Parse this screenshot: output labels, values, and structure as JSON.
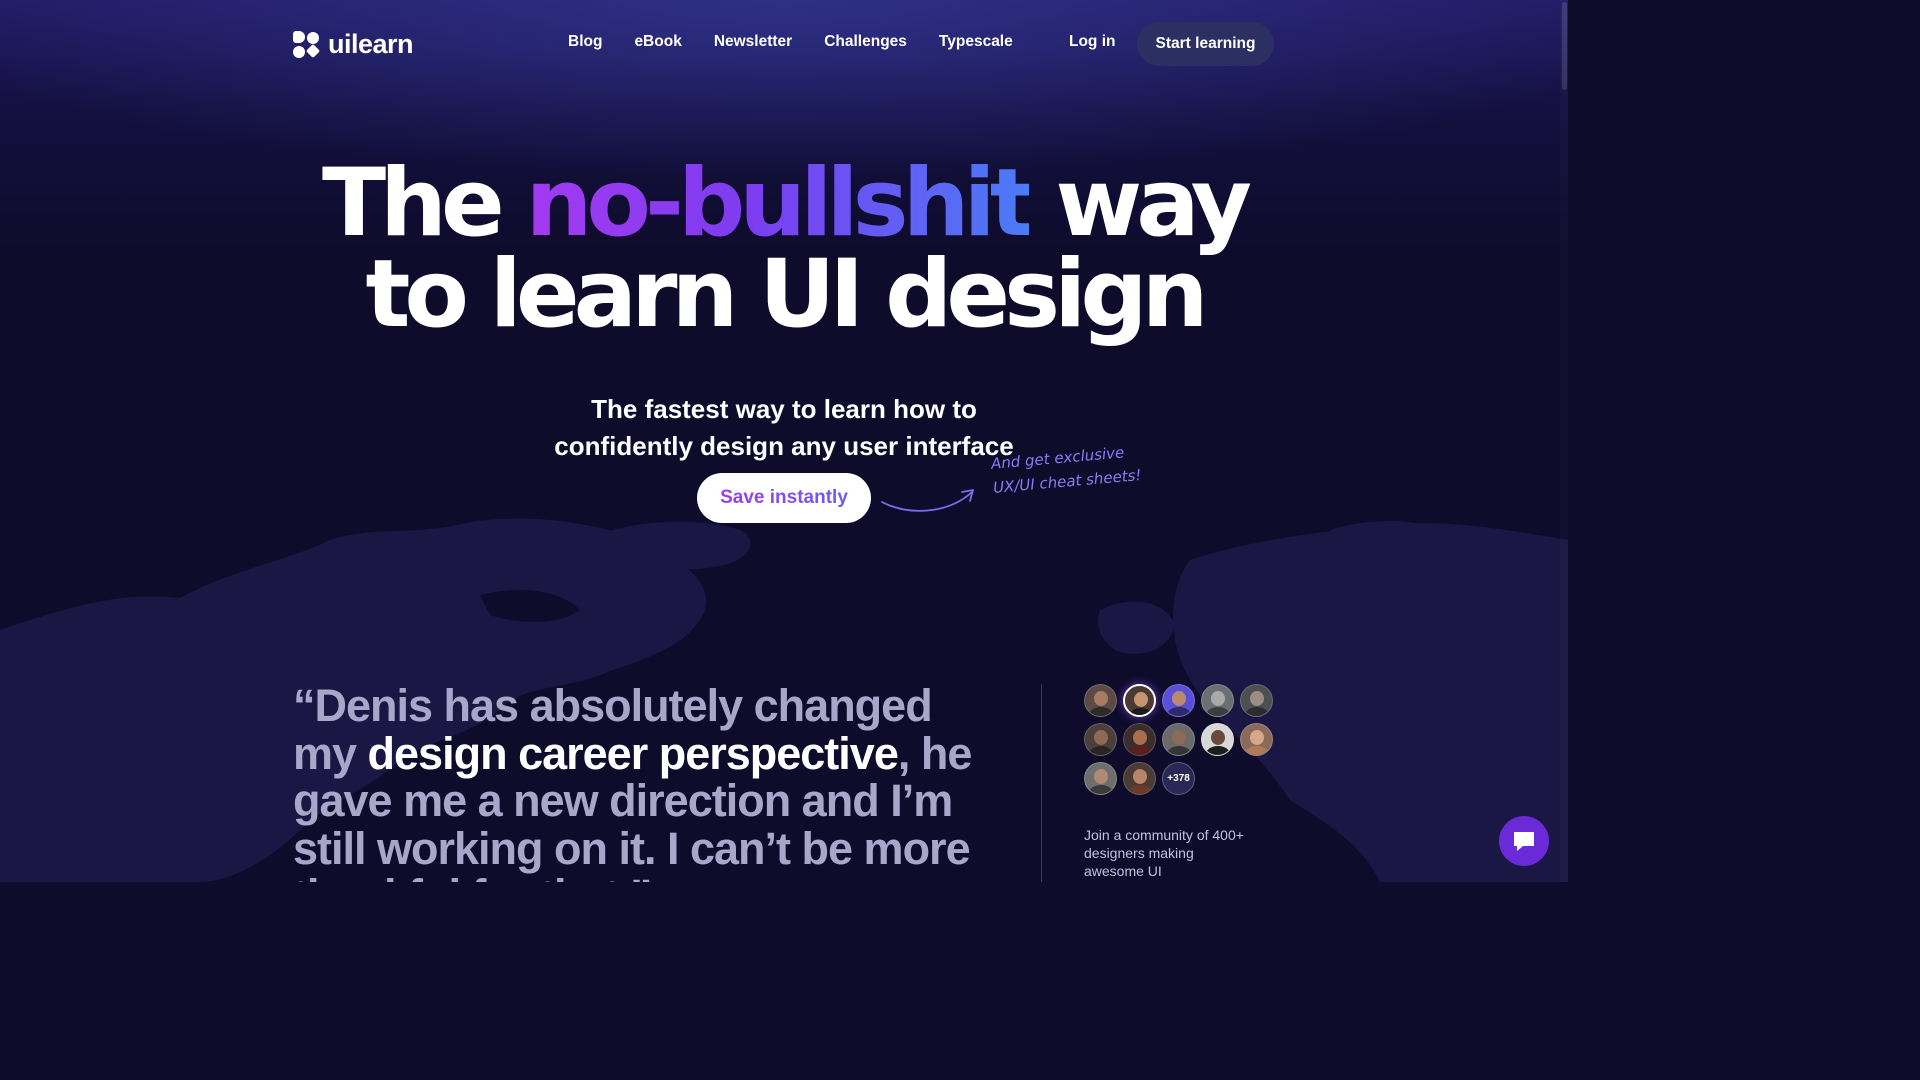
{
  "nav": {
    "logo_text": "uilearn",
    "links": [
      "Blog",
      "eBook",
      "Newsletter",
      "Challenges",
      "Typescale"
    ],
    "login_label": "Log in",
    "cta_label": "Start learning"
  },
  "hero": {
    "title_before": "The ",
    "title_highlight": "no-bullshit",
    "title_after": " way",
    "title_line2": "to learn UI design",
    "subtitle_line1": "The fastest way to learn how to",
    "subtitle_line2": "confidently design any user interface",
    "button_label": "Save instantly",
    "note_line1": "And get exclusive",
    "note_line2": "UX/UI cheat sheets!"
  },
  "testimonial": {
    "before": "“Denis has absolutely changed my ",
    "highlight": "design career perspective",
    "after": ", he gave me a new direction and I’m still working on it. I can’t be more thankful for that.”"
  },
  "community": {
    "more_count": "+378",
    "text": "Join a community of 400+ designers making awesome UI"
  },
  "colors": {
    "background": "#0e0b2b",
    "gradient_start": "#a33af0",
    "gradient_end": "#4a7cf6",
    "chat_button": "#6a2ad8"
  },
  "icons": [
    "logo-icon",
    "curved-arrow-icon",
    "chat-icon"
  ]
}
